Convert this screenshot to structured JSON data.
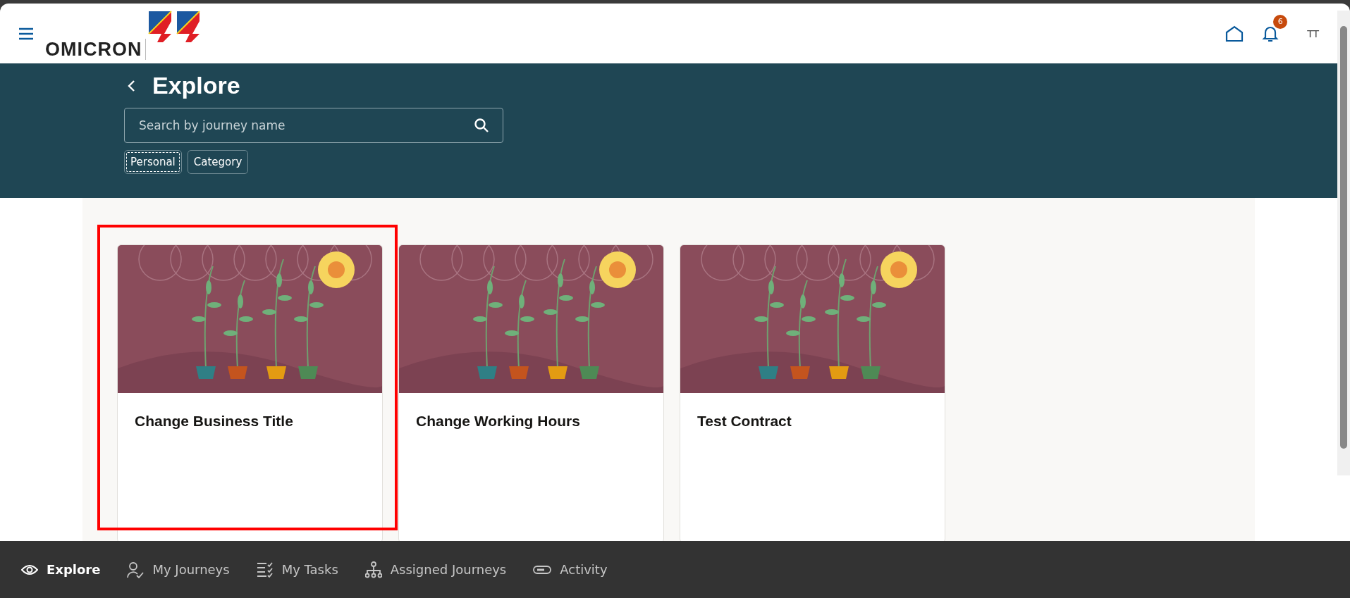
{
  "header": {
    "logo_text": "OMICRON",
    "notification_count": "6",
    "user_initials": "TT"
  },
  "page": {
    "title": "Explore"
  },
  "search": {
    "placeholder": "Search by journey name"
  },
  "filters": [
    {
      "label": "Personal",
      "selected": true
    },
    {
      "label": "Category",
      "selected": false
    }
  ],
  "cards": [
    {
      "title": "Change Business Title",
      "highlighted": true
    },
    {
      "title": "Change Working Hours",
      "highlighted": false
    },
    {
      "title": "Test Contract",
      "highlighted": false
    }
  ],
  "bottom_nav": [
    {
      "label": "Explore",
      "selected": true
    },
    {
      "label": "My Journeys",
      "selected": false
    },
    {
      "label": "My Tasks",
      "selected": false
    },
    {
      "label": "Assigned Journeys",
      "selected": false
    },
    {
      "label": "Activity",
      "selected": false
    }
  ]
}
